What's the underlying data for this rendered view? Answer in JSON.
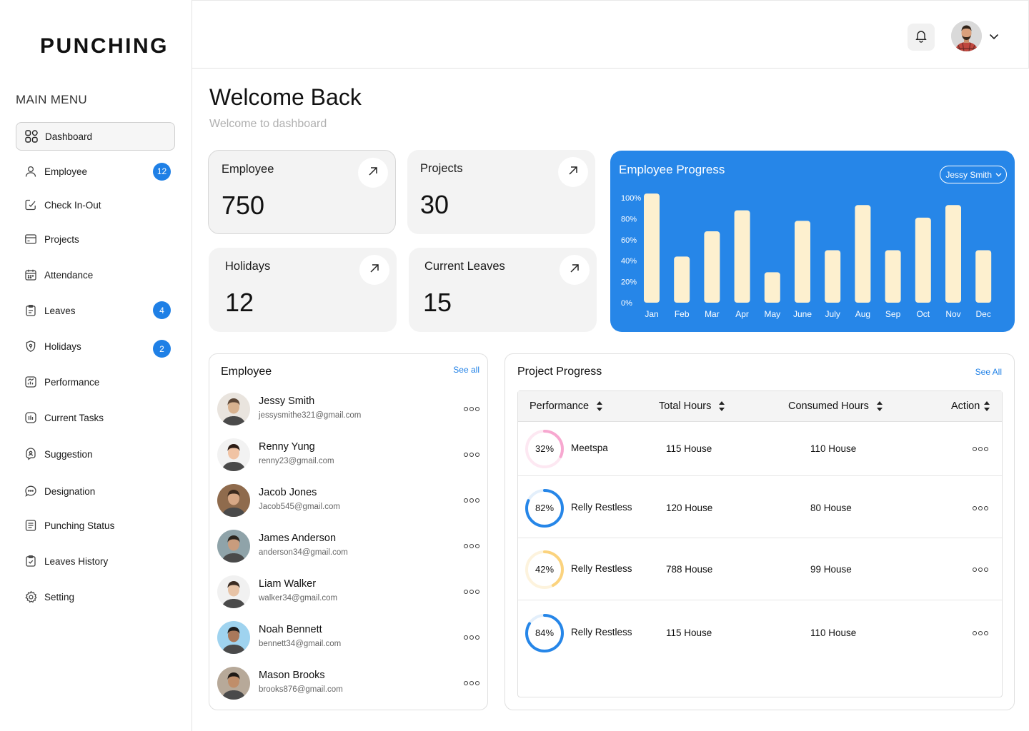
{
  "brand": "PUNCHING",
  "menu_title": "MAIN MENU",
  "nav": [
    {
      "label": "Dashboard",
      "icon": "dashboard-grid-icon",
      "active": true
    },
    {
      "label": "Employee",
      "icon": "user-icon",
      "badge": "12"
    },
    {
      "label": "Check In-Out",
      "icon": "check-in-out-icon"
    },
    {
      "label": "Projects",
      "icon": "projects-icon"
    },
    {
      "label": "Attendance",
      "icon": "calendar-icon"
    },
    {
      "label": "Leaves",
      "icon": "clipboard-icon",
      "badge": "4"
    },
    {
      "label": "Holidays",
      "icon": "holidays-icon",
      "badge": "2"
    },
    {
      "label": "Performance",
      "icon": "performance-icon"
    },
    {
      "label": "Current Tasks",
      "icon": "tasks-icon"
    },
    {
      "label": "Suggestion",
      "icon": "suggestion-icon"
    },
    {
      "label": "Designation",
      "icon": "designation-icon"
    },
    {
      "label": "Punching Status",
      "icon": "document-icon"
    },
    {
      "label": "Leaves History",
      "icon": "history-icon"
    },
    {
      "label": "Setting",
      "icon": "gear-icon"
    }
  ],
  "header": {
    "bell_icon": "bell-icon",
    "avatar": "user-avatar",
    "menu_icon": "chevron-down-icon"
  },
  "welcome": {
    "title": "Welcome Back",
    "subtitle": "Welcome to dashboard"
  },
  "stats": [
    {
      "label": "Employee",
      "value": "750"
    },
    {
      "label": "Projects",
      "value": "30"
    },
    {
      "label": "Holidays",
      "value": "12"
    },
    {
      "label": "Current Leaves",
      "value": "15"
    }
  ],
  "chart_data": {
    "type": "bar",
    "title": "Employee Progress",
    "selected_employee": "Jessy Smith",
    "categories": [
      "Jan",
      "Feb",
      "Mar",
      "Apr",
      "May",
      "June",
      "July",
      "Aug",
      "Sep",
      "Oct",
      "Nov",
      "Dec"
    ],
    "values": [
      104,
      44,
      68,
      88,
      29,
      78,
      50,
      93,
      50,
      81,
      93,
      50
    ],
    "ylim": [
      0,
      100
    ],
    "yticks": [
      "0%",
      "20%",
      "40%",
      "60%",
      "80%",
      "100%"
    ],
    "xlabel": "",
    "ylabel": "",
    "bar_color": "#fdf0cf",
    "background": "#2686e8",
    "grid": false
  },
  "employees_panel": {
    "title": "Employee",
    "see_all": "See all",
    "rows": [
      {
        "name": "Jessy Smith",
        "email": "jessysmithe321@gmail.com"
      },
      {
        "name": "Renny Yung",
        "email": "renny23@gmail.com"
      },
      {
        "name": "Jacob Jones",
        "email": "Jacob545@gmail.com"
      },
      {
        "name": "James Anderson",
        "email": "anderson34@gmail.com"
      },
      {
        "name": "Liam Walker",
        "email": "walker34@gmail.com"
      },
      {
        "name": "Noah Bennett",
        "email": "bennett34@gmail.com"
      },
      {
        "name": "Mason Brooks",
        "email": "brooks876@gmail.com"
      }
    ]
  },
  "project_panel": {
    "title": "Project Progress",
    "see_all": "See All",
    "columns": [
      "Performance",
      "Total Hours",
      "Consumed Hours",
      "Action"
    ],
    "rows": [
      {
        "percent": 32,
        "percent_label": "32%",
        "name": "Meetspa",
        "total": "115 House",
        "consumed": "110 House",
        "color": "#f7a8d0",
        "track": "#fde8f2"
      },
      {
        "percent": 82,
        "percent_label": "82%",
        "name": "Relly Restless",
        "total": "120 House",
        "consumed": "80 House",
        "color": "#2686e8",
        "track": "#e3effb"
      },
      {
        "percent": 42,
        "percent_label": "42%",
        "name": "Relly Restless",
        "total": "788 House",
        "consumed": "99 House",
        "color": "#fbd37e",
        "track": "#fdf3dd"
      },
      {
        "percent": 84,
        "percent_label": "84%",
        "name": "Relly Restless",
        "total": "115 House",
        "consumed": "110 House",
        "color": "#2686e8",
        "track": "#e3effb"
      }
    ]
  }
}
